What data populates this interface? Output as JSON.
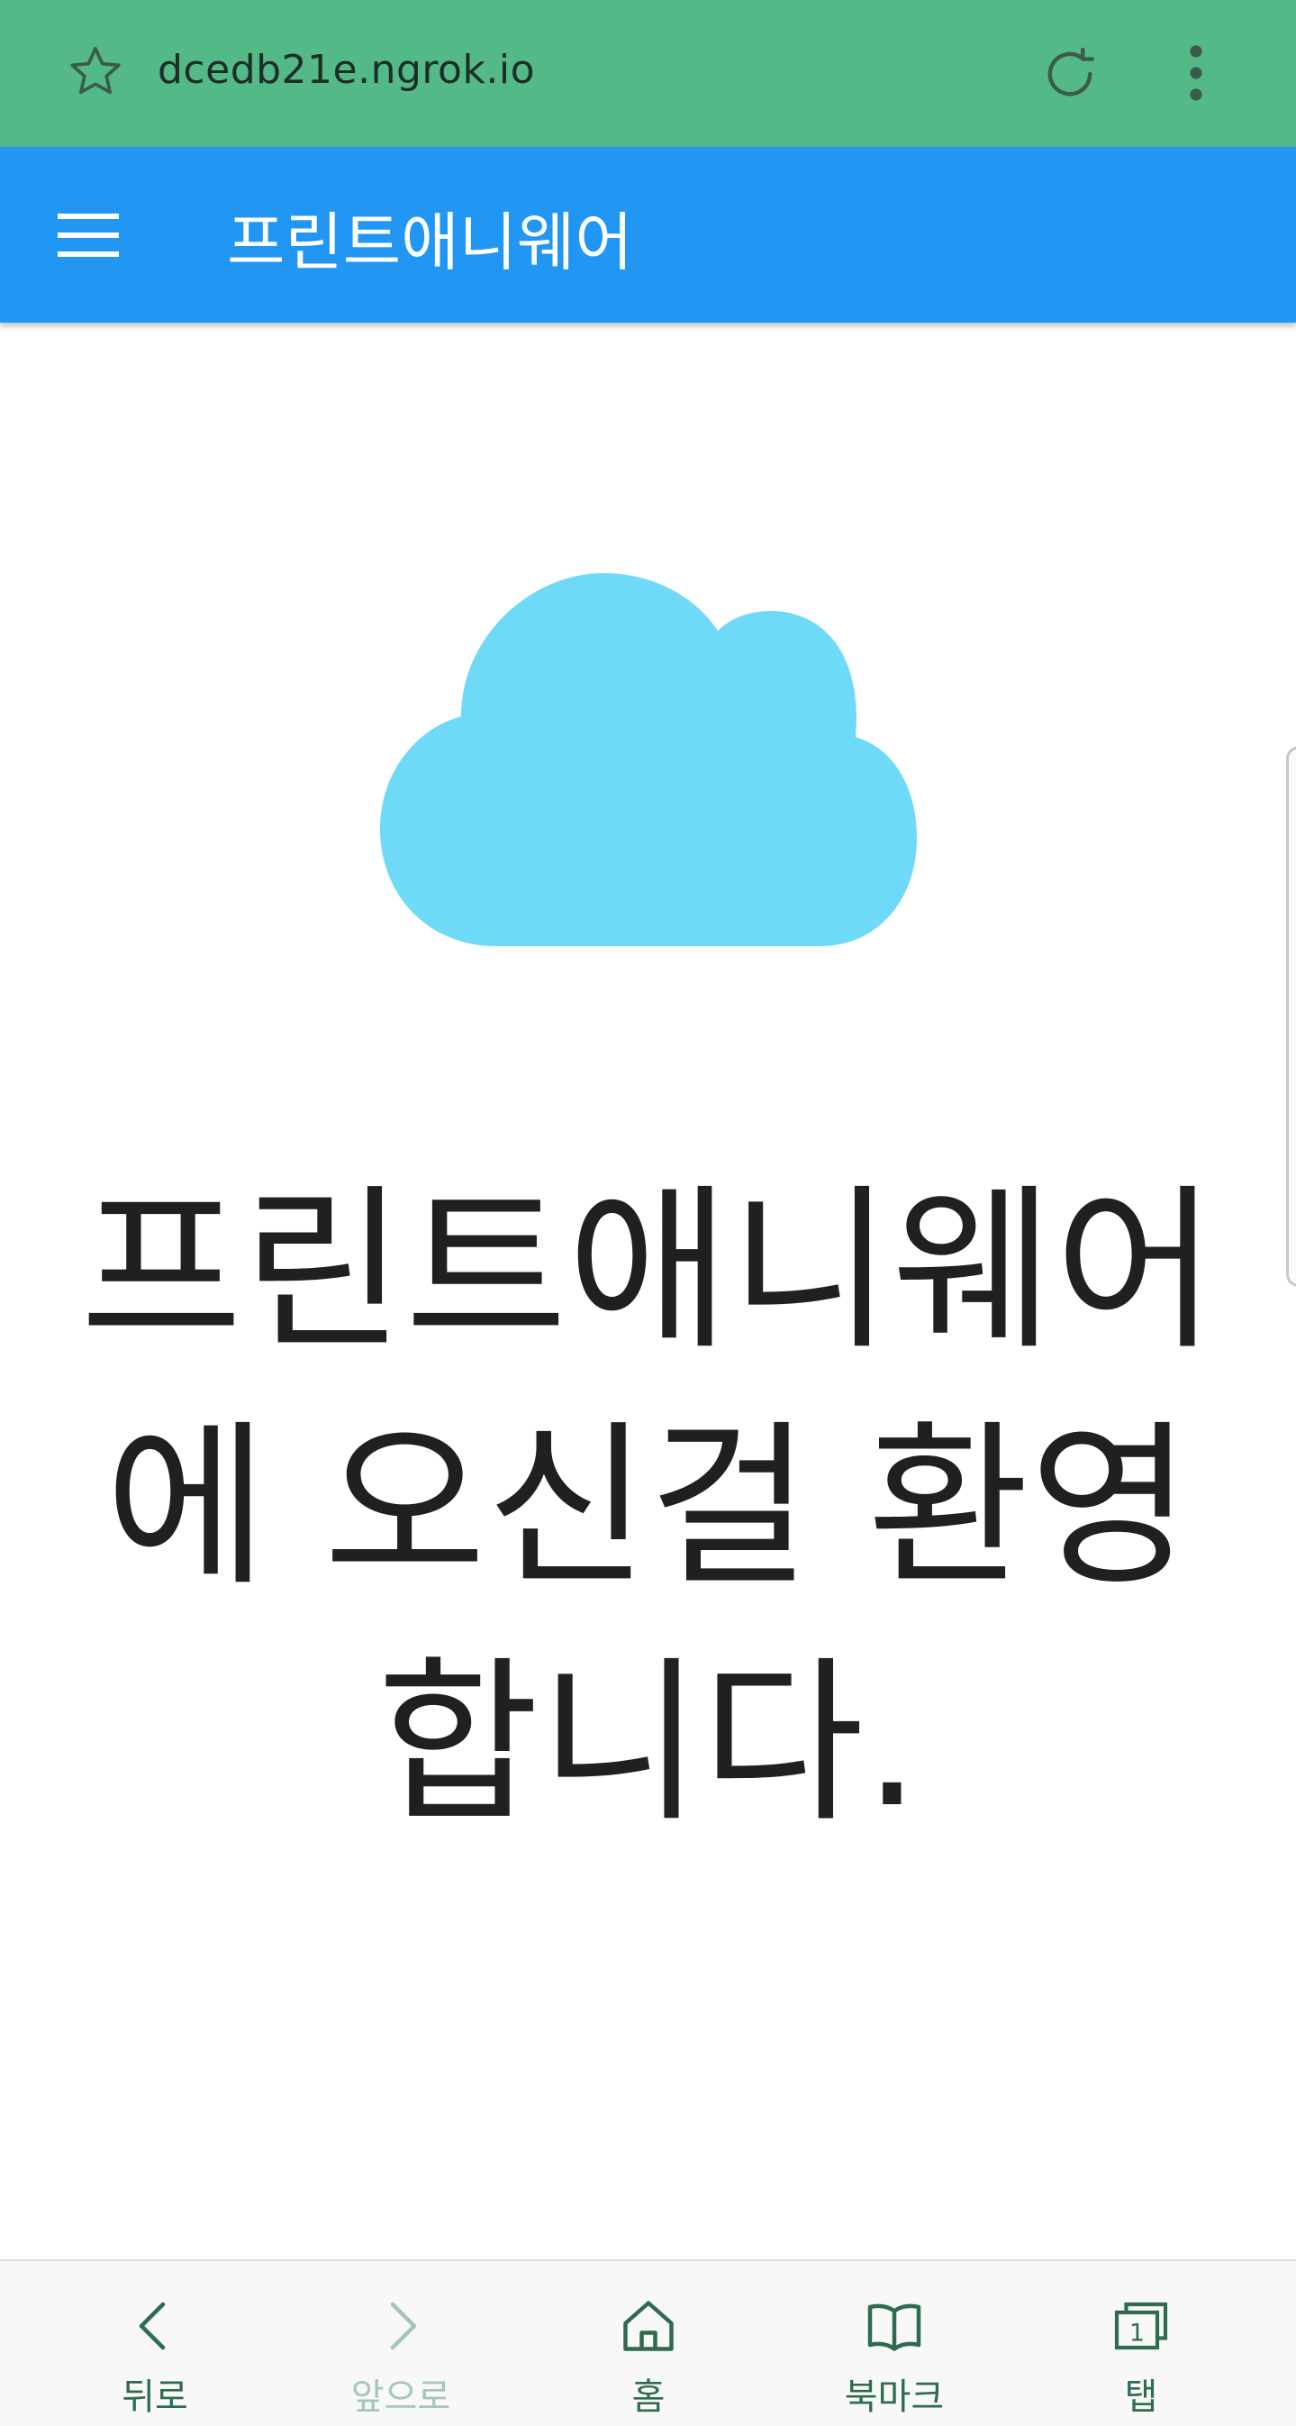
{
  "browser": {
    "url": "dcedb21e.ngrok.io",
    "icons": [
      "star-icon",
      "reload-icon",
      "more-vert-icon"
    ]
  },
  "appbar": {
    "title": "프린트애니웨어",
    "menu_icon": "menu-icon"
  },
  "main": {
    "welcome_text": "프린트애니웨어에 오신걸 환영합니다.",
    "cloud_icon": "cloud-icon"
  },
  "bottom_nav": {
    "items": [
      {
        "label": "뒤로",
        "icon": "chevron-left-icon",
        "enabled": true
      },
      {
        "label": "앞으로",
        "icon": "chevron-right-icon",
        "enabled": false
      },
      {
        "label": "홈",
        "icon": "home-icon",
        "enabled": true
      },
      {
        "label": "북마크",
        "icon": "bookmark-book-icon",
        "enabled": true
      },
      {
        "label": "탭",
        "icon": "tabs-icon",
        "enabled": true,
        "badge": "1"
      }
    ]
  },
  "colors": {
    "urlbar": "#52b987",
    "appbar": "#2196f3",
    "cloud": "#6fdaf8",
    "nav_text": "#2e6b4f",
    "nav_text_disabled": "#a5c7b6"
  }
}
